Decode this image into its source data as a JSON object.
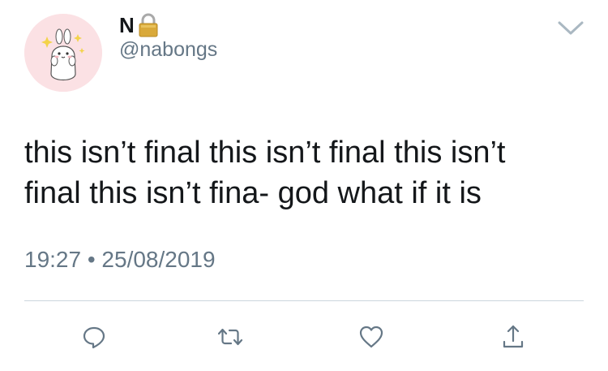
{
  "author": {
    "display_name": "N",
    "handle": "@nabongs",
    "avatar_icon": "bunny-avatar",
    "lock_icon": "lock-icon"
  },
  "tweet": {
    "text": "this isn’t final this isn’t final this isn’t\nfinal this isn’t fina- god what if it is",
    "timestamp": "19:27 • 25/08/2019"
  },
  "actions": [
    {
      "name": "reply",
      "icon": "comment-icon"
    },
    {
      "name": "retweet",
      "icon": "retweet-icon"
    },
    {
      "name": "like",
      "icon": "heart-icon"
    },
    {
      "name": "share",
      "icon": "share-icon"
    }
  ],
  "colors": {
    "text": "#14171a",
    "secondary": "#657786",
    "divider": "#ccd6dd",
    "avatar_bg": "#fbe1e4"
  }
}
